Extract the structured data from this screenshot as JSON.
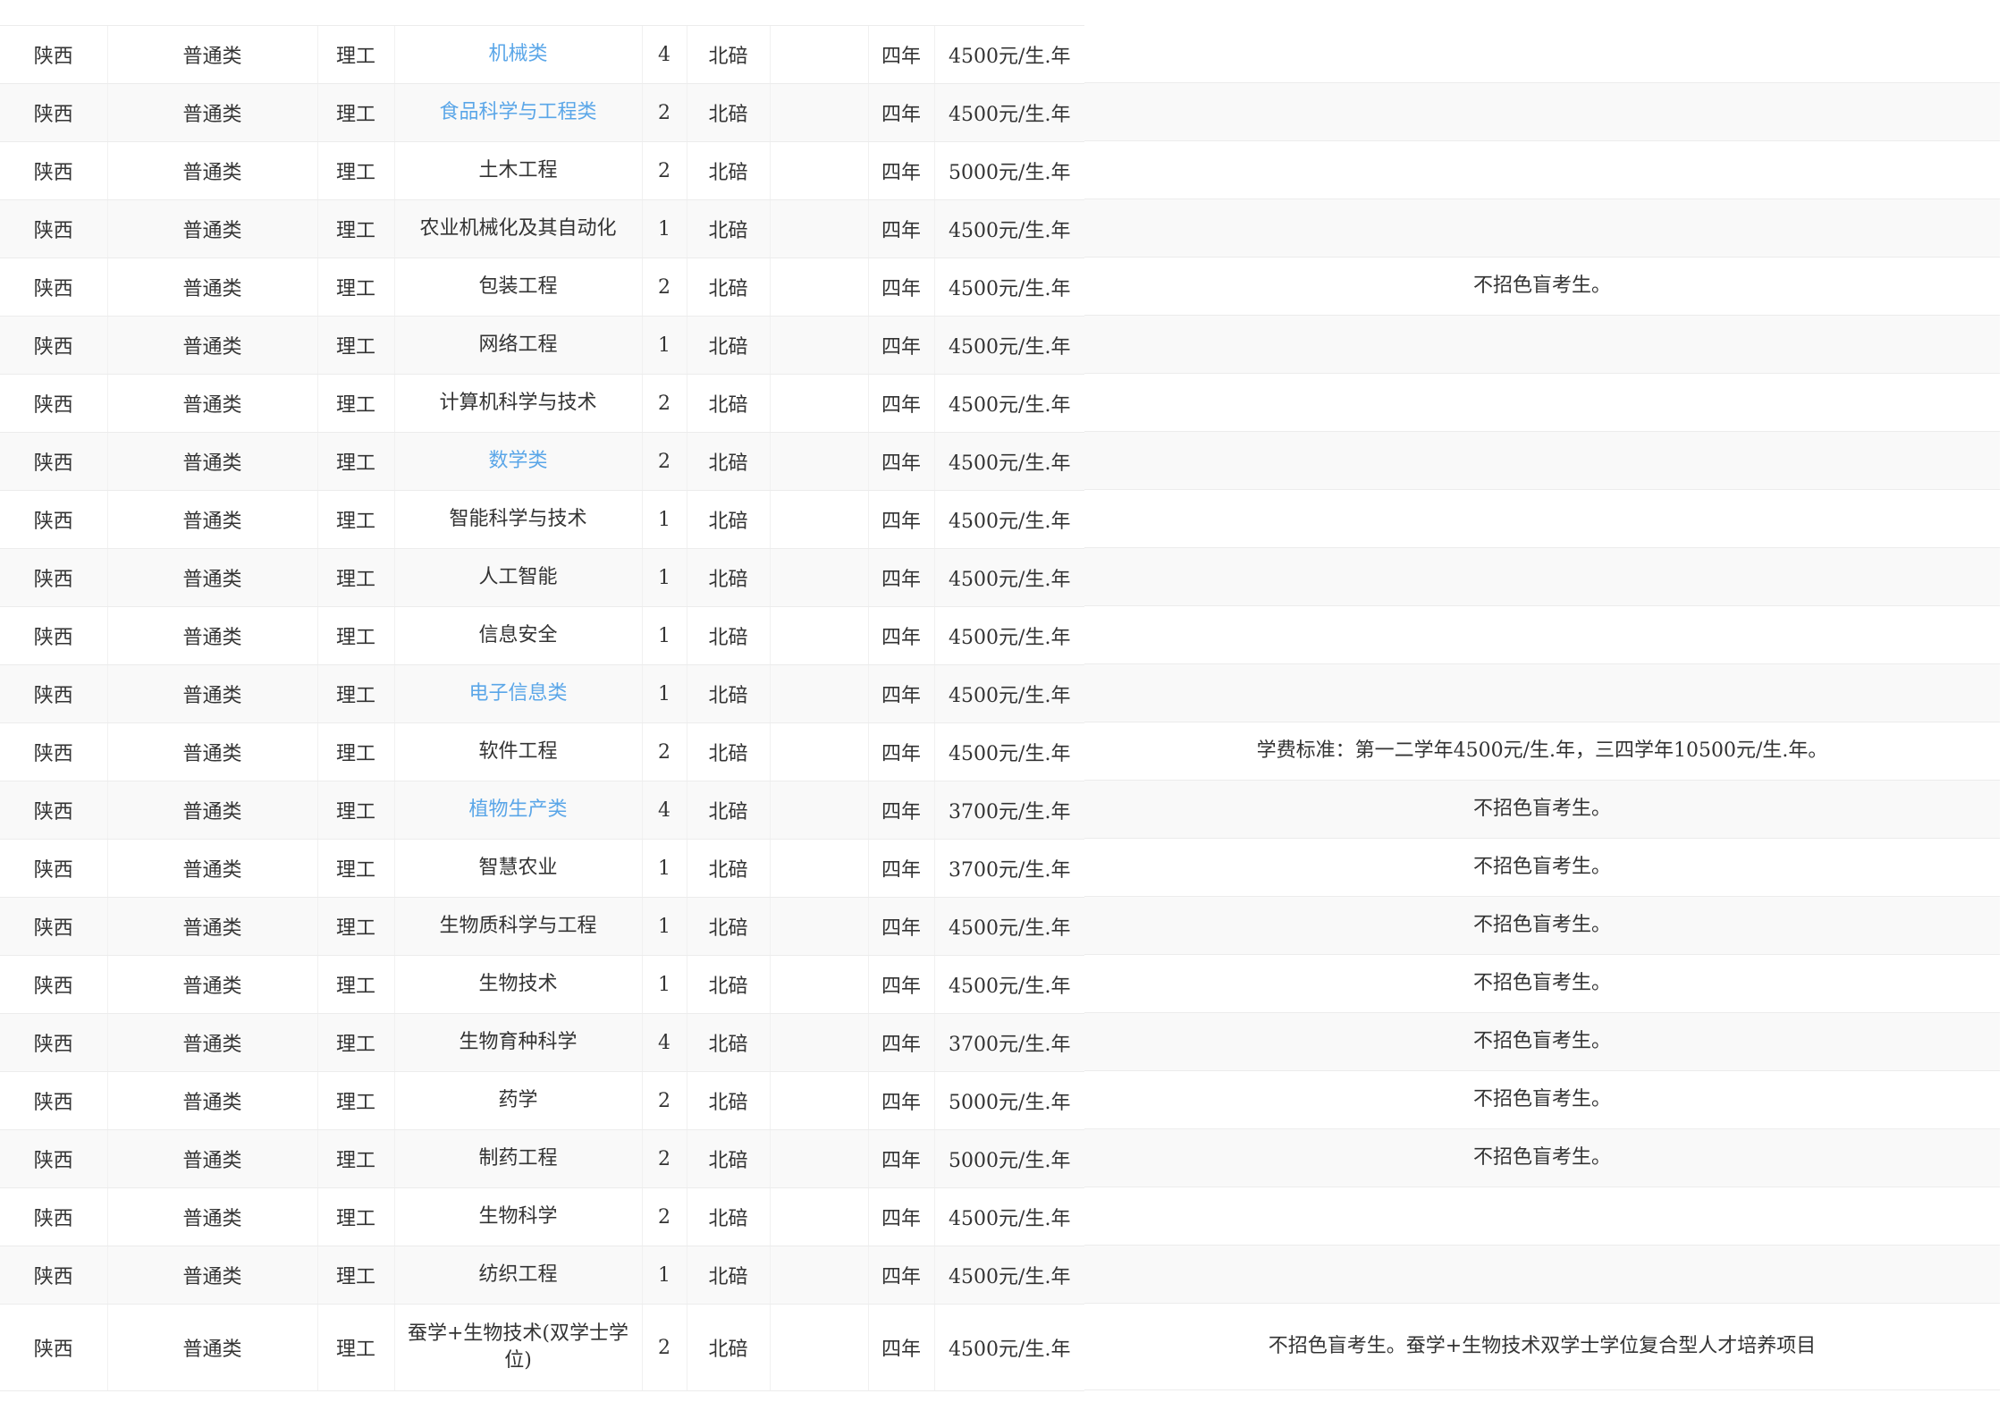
{
  "rows": [
    {
      "province": "陕西",
      "category": "普通类",
      "subject": "理工",
      "major": "机械类",
      "major_is_link": true,
      "count": "4",
      "campus": "北碚",
      "extra": "",
      "duration": "四年",
      "fee": "4500元/生.年",
      "note": ""
    },
    {
      "province": "陕西",
      "category": "普通类",
      "subject": "理工",
      "major": "食品科学与工程类",
      "major_is_link": true,
      "count": "2",
      "campus": "北碚",
      "extra": "",
      "duration": "四年",
      "fee": "4500元/生.年",
      "note": ""
    },
    {
      "province": "陕西",
      "category": "普通类",
      "subject": "理工",
      "major": "土木工程",
      "major_is_link": false,
      "count": "2",
      "campus": "北碚",
      "extra": "",
      "duration": "四年",
      "fee": "5000元/生.年",
      "note": ""
    },
    {
      "province": "陕西",
      "category": "普通类",
      "subject": "理工",
      "major": "农业机械化及其自动化",
      "major_is_link": false,
      "count": "1",
      "campus": "北碚",
      "extra": "",
      "duration": "四年",
      "fee": "4500元/生.年",
      "note": ""
    },
    {
      "province": "陕西",
      "category": "普通类",
      "subject": "理工",
      "major": "包装工程",
      "major_is_link": false,
      "count": "2",
      "campus": "北碚",
      "extra": "",
      "duration": "四年",
      "fee": "4500元/生.年",
      "note": "不招色盲考生。"
    },
    {
      "province": "陕西",
      "category": "普通类",
      "subject": "理工",
      "major": "网络工程",
      "major_is_link": false,
      "count": "1",
      "campus": "北碚",
      "extra": "",
      "duration": "四年",
      "fee": "4500元/生.年",
      "note": ""
    },
    {
      "province": "陕西",
      "category": "普通类",
      "subject": "理工",
      "major": "计算机科学与技术",
      "major_is_link": false,
      "count": "2",
      "campus": "北碚",
      "extra": "",
      "duration": "四年",
      "fee": "4500元/生.年",
      "note": ""
    },
    {
      "province": "陕西",
      "category": "普通类",
      "subject": "理工",
      "major": "数学类",
      "major_is_link": true,
      "count": "2",
      "campus": "北碚",
      "extra": "",
      "duration": "四年",
      "fee": "4500元/生.年",
      "note": ""
    },
    {
      "province": "陕西",
      "category": "普通类",
      "subject": "理工",
      "major": "智能科学与技术",
      "major_is_link": false,
      "count": "1",
      "campus": "北碚",
      "extra": "",
      "duration": "四年",
      "fee": "4500元/生.年",
      "note": ""
    },
    {
      "province": "陕西",
      "category": "普通类",
      "subject": "理工",
      "major": "人工智能",
      "major_is_link": false,
      "count": "1",
      "campus": "北碚",
      "extra": "",
      "duration": "四年",
      "fee": "4500元/生.年",
      "note": ""
    },
    {
      "province": "陕西",
      "category": "普通类",
      "subject": "理工",
      "major": "信息安全",
      "major_is_link": false,
      "count": "1",
      "campus": "北碚",
      "extra": "",
      "duration": "四年",
      "fee": "4500元/生.年",
      "note": ""
    },
    {
      "province": "陕西",
      "category": "普通类",
      "subject": "理工",
      "major": "电子信息类",
      "major_is_link": true,
      "count": "1",
      "campus": "北碚",
      "extra": "",
      "duration": "四年",
      "fee": "4500元/生.年",
      "note": ""
    },
    {
      "province": "陕西",
      "category": "普通类",
      "subject": "理工",
      "major": "软件工程",
      "major_is_link": false,
      "count": "2",
      "campus": "北碚",
      "extra": "",
      "duration": "四年",
      "fee": "4500元/生.年",
      "note": "学费标准：第一二学年4500元/生.年，三四学年10500元/生.年。"
    },
    {
      "province": "陕西",
      "category": "普通类",
      "subject": "理工",
      "major": "植物生产类",
      "major_is_link": true,
      "count": "4",
      "campus": "北碚",
      "extra": "",
      "duration": "四年",
      "fee": "3700元/生.年",
      "note": "不招色盲考生。"
    },
    {
      "province": "陕西",
      "category": "普通类",
      "subject": "理工",
      "major": "智慧农业",
      "major_is_link": false,
      "count": "1",
      "campus": "北碚",
      "extra": "",
      "duration": "四年",
      "fee": "3700元/生.年",
      "note": "不招色盲考生。"
    },
    {
      "province": "陕西",
      "category": "普通类",
      "subject": "理工",
      "major": "生物质科学与工程",
      "major_is_link": false,
      "count": "1",
      "campus": "北碚",
      "extra": "",
      "duration": "四年",
      "fee": "4500元/生.年",
      "note": "不招色盲考生。"
    },
    {
      "province": "陕西",
      "category": "普通类",
      "subject": "理工",
      "major": "生物技术",
      "major_is_link": false,
      "count": "1",
      "campus": "北碚",
      "extra": "",
      "duration": "四年",
      "fee": "4500元/生.年",
      "note": "不招色盲考生。"
    },
    {
      "province": "陕西",
      "category": "普通类",
      "subject": "理工",
      "major": "生物育种科学",
      "major_is_link": false,
      "count": "4",
      "campus": "北碚",
      "extra": "",
      "duration": "四年",
      "fee": "3700元/生.年",
      "note": "不招色盲考生。"
    },
    {
      "province": "陕西",
      "category": "普通类",
      "subject": "理工",
      "major": "药学",
      "major_is_link": false,
      "count": "2",
      "campus": "北碚",
      "extra": "",
      "duration": "四年",
      "fee": "5000元/生.年",
      "note": "不招色盲考生。"
    },
    {
      "province": "陕西",
      "category": "普通类",
      "subject": "理工",
      "major": "制药工程",
      "major_is_link": false,
      "count": "2",
      "campus": "北碚",
      "extra": "",
      "duration": "四年",
      "fee": "5000元/生.年",
      "note": "不招色盲考生。"
    },
    {
      "province": "陕西",
      "category": "普通类",
      "subject": "理工",
      "major": "生物科学",
      "major_is_link": false,
      "count": "2",
      "campus": "北碚",
      "extra": "",
      "duration": "四年",
      "fee": "4500元/生.年",
      "note": ""
    },
    {
      "province": "陕西",
      "category": "普通类",
      "subject": "理工",
      "major": "纺织工程",
      "major_is_link": false,
      "count": "1",
      "campus": "北碚",
      "extra": "",
      "duration": "四年",
      "fee": "4500元/生.年",
      "note": ""
    },
    {
      "province": "陕西",
      "category": "普通类",
      "subject": "理工",
      "major": "蚕学+生物技术(双学士学位)",
      "major_is_link": false,
      "count": "2",
      "campus": "北碚",
      "extra": "",
      "duration": "四年",
      "fee": "4500元/生.年",
      "note": "不招色盲考生。蚕学+生物技术双学士学位复合型人才培养项目"
    }
  ],
  "colors": {
    "link": "#5aa6e8",
    "text": "#333333",
    "stripe": "#f9f9f9",
    "border": "#ececec"
  }
}
